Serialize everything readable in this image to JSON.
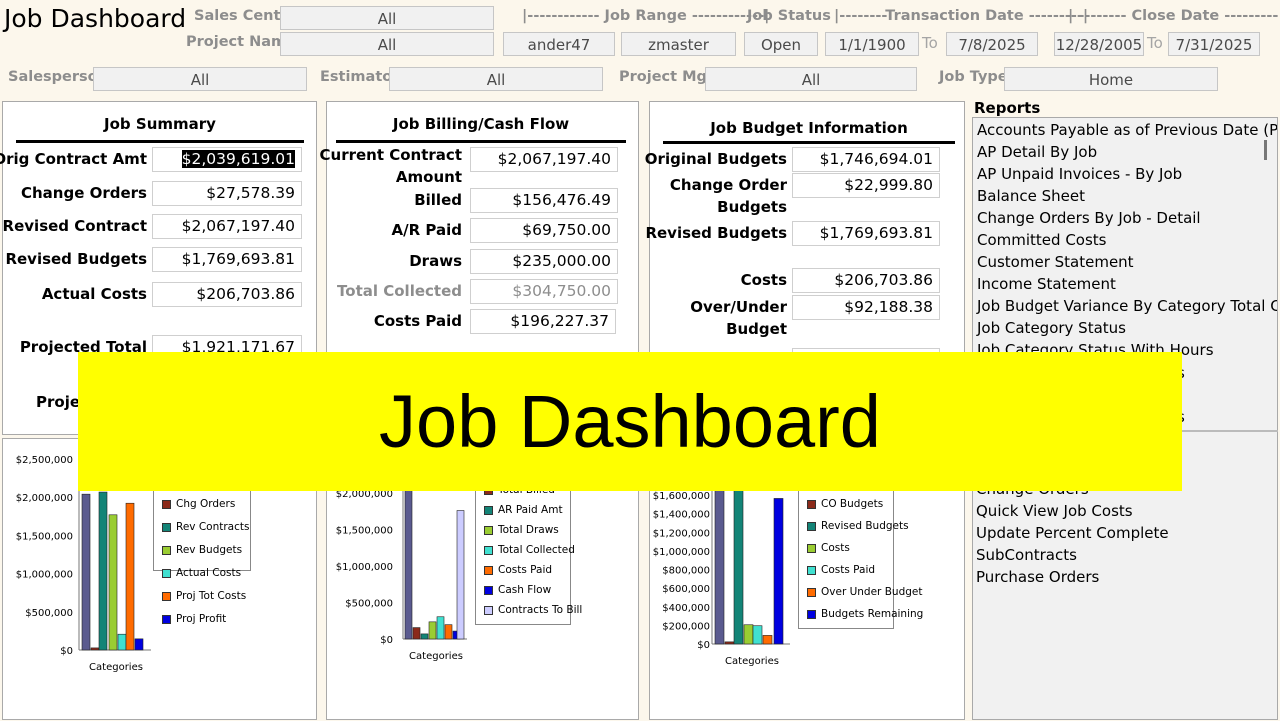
{
  "app": {
    "title": "Job Dashboard"
  },
  "banner": {
    "text": "Job Dashboard"
  },
  "filters": {
    "sales_center": {
      "label": "Sales Center",
      "value": "All"
    },
    "project_name": {
      "label": "Project Name",
      "value": "All"
    },
    "job_range": {
      "label": "|------------ Job Range ------------|",
      "from": "ander47",
      "to": "zmaster"
    },
    "job_status": {
      "label": "Job Status",
      "value": "Open"
    },
    "transaction_date": {
      "label": "|--------Transaction Date ---------|",
      "from": "1/1/1900",
      "to_label": "To",
      "to": "7/8/2025"
    },
    "close_date": {
      "label": "|  --------   Close Date  ---------|",
      "from": "12/28/2005",
      "to_label": "To",
      "to": "7/31/2025"
    },
    "salesperson": {
      "label": "Salesperson",
      "value": "All"
    },
    "estimator": {
      "label": "Estimator",
      "value": "All"
    },
    "project_mgr": {
      "label": "Project Mgr",
      "value": "All"
    },
    "job_type": {
      "label": "Job Type",
      "value": "Home"
    }
  },
  "job_summary": {
    "title": "Job Summary",
    "rows": [
      {
        "label": "Orig Contract Amt",
        "value": "$2,039,619.01"
      },
      {
        "label": "Change Orders",
        "value": "$27,578.39"
      },
      {
        "label": "Revised Contract",
        "value": "$2,067,197.40"
      },
      {
        "label": "Revised Budgets",
        "value": "$1,769,693.81"
      },
      {
        "label": "Actual Costs",
        "value": "$206,703.86"
      },
      {
        "label": "Projected Total",
        "value": "$1,921,171.67"
      },
      {
        "label": "Projec"
      }
    ]
  },
  "billing": {
    "title": "Job Billing/Cash Flow",
    "rows": [
      {
        "label": "Current Contract",
        "label2": "Amount",
        "value": "$2,067,197.40"
      },
      {
        "label": "Billed",
        "value": "$156,476.49"
      },
      {
        "label": "A/R Paid",
        "value": "$69,750.00"
      },
      {
        "label": "Draws",
        "value": "$235,000.00"
      },
      {
        "label": "Total Collected",
        "value": "$304,750.00"
      },
      {
        "label": "Costs Paid",
        "value": "$196,227.37"
      }
    ]
  },
  "budget": {
    "title": "Job Budget Information",
    "rows": [
      {
        "label": "Original Budgets",
        "value": "$1,746,694.01"
      },
      {
        "label": "Change Order",
        "label2": "Budgets",
        "value": "$22,999.80"
      },
      {
        "label": "Revised Budgets",
        "value": "$1,769,693.81"
      },
      {
        "label": "Costs",
        "value": "$206,703.86"
      },
      {
        "label": "Over/Under",
        "label2": "Budget",
        "value": "$92,188.38"
      }
    ]
  },
  "reports": {
    "title": "Reports",
    "items": [
      "Accounts Payable as of Previous Date (Posting",
      "AP Detail By Job",
      "AP Unpaid Invoices - By Job",
      "Balance Sheet",
      "Change Orders By Job - Detail",
      "Committed Costs",
      "Customer Statement",
      "Income Statement",
      "Job Budget Variance By Category Total Codes",
      "Job Category Status",
      "Job Category Status With Hours"
    ],
    "partial": [
      "s",
      "s"
    ],
    "items2": [
      "Change Orders",
      "Quick View Job Costs",
      "Update Percent Complete",
      "SubContracts",
      "Purchase Orders"
    ]
  },
  "colors": {
    "contract": "#5a5a8f",
    "chg": "#8b2a1a",
    "teal": "#138477",
    "green": "#9acd32",
    "cyan": "#40e0d0",
    "orange": "#ff6b00",
    "blue": "#0000e0",
    "lav": "#ccccff",
    "banner": "#ffff00"
  },
  "chart_data": [
    {
      "type": "bar",
      "xlabel": "Categories",
      "ylim": [
        0,
        2500000
      ],
      "yticks": [
        "$2,500,000",
        "$2,000,000",
        "$1,500,000",
        "$1,000,000",
        "$500,000",
        "$0"
      ],
      "series": [
        {
          "value": 2039619.01,
          "color": "#5a5a8f"
        },
        {
          "name": "Chg Orders",
          "value": 27578.39,
          "color": "#8b2a1a"
        },
        {
          "name": "Rev Contracts",
          "value": 2067197.4,
          "color": "#138477"
        },
        {
          "name": "Rev Budgets",
          "value": 1769693.81,
          "color": "#9acd32"
        },
        {
          "name": "Actual Costs",
          "value": 206703.86,
          "color": "#40e0d0"
        },
        {
          "name": "Proj Tot Costs",
          "value": 1921171.67,
          "color": "#ff6b00"
        },
        {
          "name": "Proj Profit",
          "value": 146025.73,
          "color": "#0000e0"
        }
      ]
    },
    {
      "type": "bar",
      "xlabel": "Categories",
      "ylim": [
        0,
        2000000
      ],
      "yticks": [
        "$2,000,000",
        "$1,500,000",
        "$1,000,000",
        "$500,000",
        "$0"
      ],
      "series": [
        {
          "value": 2067197.4,
          "color": "#5a5a8f"
        },
        {
          "name": "Total Billed",
          "value": 156476.49,
          "color": "#8b2a1a"
        },
        {
          "name": "AR Paid Amt",
          "value": 69750.0,
          "color": "#138477"
        },
        {
          "name": "Total Draws",
          "value": 235000.0,
          "color": "#9acd32"
        },
        {
          "name": "Total Collected",
          "value": 304750.0,
          "color": "#40e0d0"
        },
        {
          "name": "Costs Paid",
          "value": 196227.37,
          "color": "#ff6b00"
        },
        {
          "name": "Cash Flow",
          "value": 108522.63,
          "color": "#0000e0"
        },
        {
          "name": "Contracts To Bill",
          "value": 1760000,
          "color": "#ccccff"
        }
      ]
    },
    {
      "type": "bar",
      "xlabel": "Categories",
      "ylim": [
        0,
        1600000
      ],
      "yticks": [
        "$1,600,000",
        "$1,400,000",
        "$1,200,000",
        "$1,000,000",
        "$800,000",
        "$600,000",
        "$400,000",
        "$200,000",
        "$0"
      ],
      "series": [
        {
          "value": 1746694.01,
          "color": "#5a5a8f"
        },
        {
          "name": "CO Budgets",
          "value": 22999.8,
          "color": "#8b2a1a"
        },
        {
          "name": "Revised Budgets",
          "value": 1769693.81,
          "color": "#138477"
        },
        {
          "name": "Costs",
          "value": 206703.86,
          "color": "#9acd32"
        },
        {
          "name": "Costs Paid",
          "value": 196227.37,
          "color": "#40e0d0"
        },
        {
          "name": "Over Under Budget",
          "value": 92188.38,
          "color": "#ff6b00"
        },
        {
          "name": "Budgets Remaining",
          "value": 1562989.95,
          "color": "#0000e0"
        }
      ]
    }
  ]
}
